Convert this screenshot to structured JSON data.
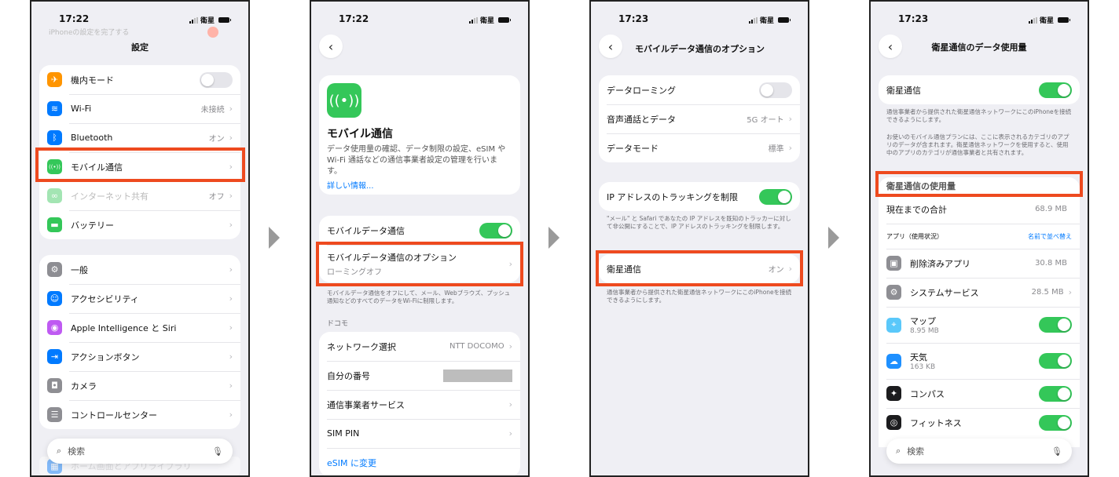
{
  "arrow_count": 3,
  "colors": {
    "highlight": "#ee4a1f",
    "toggle_on": "#34c759",
    "link": "#007aff"
  },
  "screen1": {
    "time": "17:22",
    "carrier": "衛星",
    "banner": "iPhoneの設定を完了する",
    "title": "設定",
    "group1": [
      {
        "label": "機内モード",
        "icon": "airplane-icon",
        "color": "#ff9500",
        "toggle": false
      },
      {
        "label": "Wi-Fi",
        "icon": "wifi-icon",
        "color": "#007aff",
        "value": "未接続"
      },
      {
        "label": "Bluetooth",
        "icon": "bluetooth-icon",
        "color": "#007aff",
        "value": "オン"
      },
      {
        "label": "モバイル通信",
        "icon": "antenna-icon",
        "color": "#34c759"
      },
      {
        "label": "インターネット共有",
        "icon": "link-icon",
        "color": "#34c759",
        "value": "オフ",
        "dimmed": true
      },
      {
        "label": "バッテリー",
        "icon": "battery-icon",
        "color": "#34c759"
      }
    ],
    "group2": [
      {
        "label": "一般",
        "icon": "gear-icon",
        "color": "#8e8e93"
      },
      {
        "label": "アクセシビリティ",
        "icon": "accessibility-icon",
        "color": "#007aff"
      },
      {
        "label": "Apple Intelligence と Siri",
        "icon": "siri-icon",
        "color": "#bf5af2"
      },
      {
        "label": "アクションボタン",
        "icon": "action-button-icon",
        "color": "#007aff"
      },
      {
        "label": "カメラ",
        "icon": "camera-icon",
        "color": "#8e8e93"
      },
      {
        "label": "コントロールセンター",
        "icon": "control-center-icon",
        "color": "#8e8e93"
      }
    ],
    "peek_row": "ホーム画面とアプリライブラリ",
    "search_placeholder": "検索"
  },
  "screen2": {
    "time": "17:22",
    "carrier": "衛星",
    "heading": "モバイル通信",
    "description": "データ使用量の確認、データ制限の設定、eSIM や Wi-Fi 通話などの通信事業者設定の管理を行います。",
    "more_link": "詳しい情報...",
    "mobile_data_label": "モバイルデータ通信",
    "mobile_data_on": true,
    "options_label": "モバイルデータ通信のオプション",
    "options_sub": "ローミングオフ",
    "note": "モバイルデータ通信をオフにして、メール、Webブラウズ、プッシュ通知などのすべてのデータをWi-Fiに制限します。",
    "section": "ドコモ",
    "rows": [
      {
        "label": "ネットワーク選択",
        "value": "NTT DOCOMO"
      },
      {
        "label": "自分の番号",
        "value": ""
      },
      {
        "label": "通信事業者サービス",
        "value": ""
      },
      {
        "label": "SIM PIN",
        "value": ""
      }
    ],
    "esim_link": "eSIM に変更"
  },
  "screen3": {
    "time": "17:23",
    "carrier": "衛星",
    "title": "モバイルデータ通信のオプション",
    "rows": [
      {
        "label": "データローミング",
        "toggle": false
      },
      {
        "label": "音声通話とデータ",
        "value": "5G オート"
      },
      {
        "label": "データモード",
        "value": "標準"
      }
    ],
    "ip_label": "IP アドレスのトラッキングを制限",
    "ip_on": true,
    "ip_note": "\"メール\" と Safari であなたの IP アドレスを既知のトラッカーに対して非公開にすることで、IP アドレスのトラッキングを制限します。",
    "sat_label": "衛星通信",
    "sat_value": "オン",
    "sat_note": "通信事業者から提供された衛星通信ネットワークにこのiPhoneを接続できるようにします。"
  },
  "screen4": {
    "time": "17:23",
    "carrier": "衛星",
    "title": "衛星通信のデータ使用量",
    "sat_label": "衛星通信",
    "sat_on": true,
    "note1": "通信事業者から提供された衛星通信ネットワークにこのiPhoneを接続できるようにします。",
    "note2": "お使いのモバイル通信プランには、ここに表示されるカテゴリのアプリのデータが含まれます。衛星通信ネットワークを使用すると、使用中のアプリのカテゴリが通信事業者と共有されます。",
    "usage_header": "衛星通信の使用量",
    "total_label": "現在までの合計",
    "total_value": "68.9 MB",
    "apps_header": "アプリ（使用状況）",
    "sort_link": "名前で並べ替え",
    "apps": [
      {
        "label": "削除済みアプリ",
        "value": "30.8 MB",
        "icon": "apps-icon",
        "color": "#8e8e93"
      },
      {
        "label": "システムサービス",
        "value": "28.5 MB",
        "icon": "gear-icon",
        "color": "#8e8e93",
        "chevron": true
      },
      {
        "label": "マップ",
        "sub": "8.95 MB",
        "icon": "maps-icon",
        "color": "#5ac8fa",
        "toggle": true
      },
      {
        "label": "天気",
        "sub": "163 KB",
        "icon": "weather-icon",
        "color": "#1e90ff",
        "toggle": true
      },
      {
        "label": "コンパス",
        "icon": "compass-icon",
        "color": "#1c1c1e",
        "toggle": true
      },
      {
        "label": "フィットネス",
        "icon": "fitness-icon",
        "color": "#1c1c1e",
        "toggle": true
      }
    ],
    "search_placeholder": "検索"
  }
}
